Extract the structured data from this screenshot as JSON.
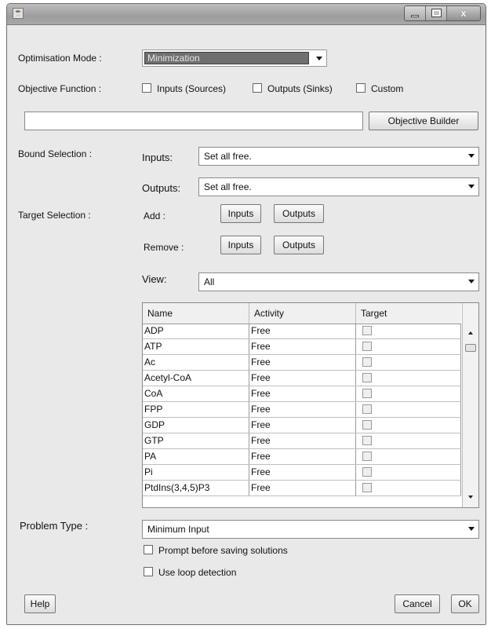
{
  "window": {
    "icon": "java-app-icon",
    "close_label": "x"
  },
  "optimisation": {
    "label": "Optimisation Mode :",
    "value": "Minimization"
  },
  "objective": {
    "label": "Objective Function :",
    "inputs_label": "Inputs (Sources)",
    "outputs_label": "Outputs (Sinks)",
    "custom_label": "Custom",
    "expression_value": "",
    "builder_label": "Objective Builder"
  },
  "bounds": {
    "label": "Bound Selection :",
    "inputs_label": "Inputs:",
    "inputs_value": "Set all free.",
    "outputs_label": "Outputs:",
    "outputs_value": "Set all free."
  },
  "targets": {
    "label": "Target Selection :",
    "add_label": "Add :",
    "remove_label": "Remove :",
    "inputs_button": "Inputs",
    "outputs_button": "Outputs",
    "view_label": "View:",
    "view_value": "All"
  },
  "table": {
    "headers": [
      "Name",
      "Activity",
      "Target"
    ],
    "rows": [
      {
        "name": "ADP",
        "activity": "Free"
      },
      {
        "name": "ATP",
        "activity": "Free"
      },
      {
        "name": "Ac",
        "activity": "Free"
      },
      {
        "name": "Acetyl-CoA",
        "activity": "Free"
      },
      {
        "name": "CoA",
        "activity": "Free"
      },
      {
        "name": "FPP",
        "activity": "Free"
      },
      {
        "name": "GDP",
        "activity": "Free"
      },
      {
        "name": "GTP",
        "activity": "Free"
      },
      {
        "name": "PA",
        "activity": "Free"
      },
      {
        "name": "Pi",
        "activity": "Free"
      },
      {
        "name": "PtdIns(3,4,5)P3",
        "activity": "Free"
      }
    ]
  },
  "problem": {
    "label": "Problem Type :",
    "value": "Minimum Input",
    "prompt_label": "Prompt before saving solutions",
    "loop_label": "Use loop detection"
  },
  "footer": {
    "help": "Help",
    "cancel": "Cancel",
    "ok": "OK"
  }
}
